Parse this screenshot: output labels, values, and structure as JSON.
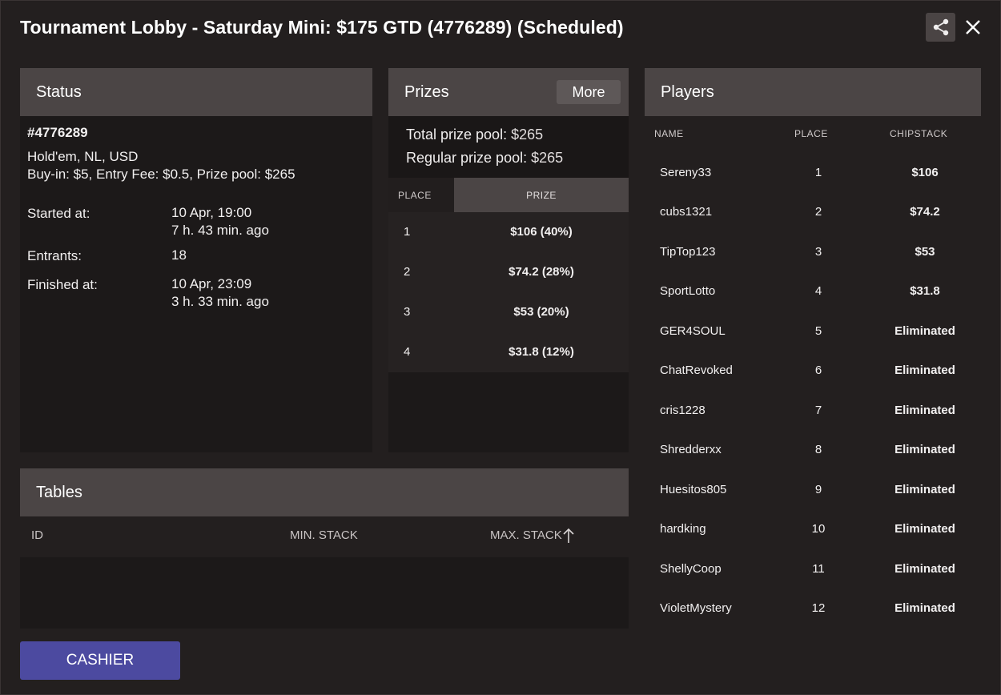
{
  "window": {
    "title": "Tournament Lobby - Saturday Mini: $175 GTD (4776289) (Scheduled)"
  },
  "status": {
    "header": "Status",
    "id": "#4776289",
    "game": "Hold'em, NL, USD",
    "buyin": "Buy-in: $5, Entry Fee: $0.5, Prize pool: $265",
    "started_label": "Started at:",
    "started_date": "10 Apr, 19:00",
    "started_ago": "7 h. 43 min. ago",
    "entrants_label": "Entrants:",
    "entrants_value": "18",
    "finished_label": "Finished at:",
    "finished_date": "10 Apr, 23:09",
    "finished_ago": "3 h. 33 min. ago"
  },
  "prizes": {
    "header": "Prizes",
    "more_label": "More",
    "total_label": "Total prize pool:",
    "total_value": "$265",
    "regular_label": "Regular prize pool:",
    "regular_value": "$265",
    "col_place": "PLACE",
    "col_prize": "PRIZE",
    "rows": [
      {
        "place": "1",
        "prize": "$106 (40%)"
      },
      {
        "place": "2",
        "prize": "$74.2 (28%)"
      },
      {
        "place": "3",
        "prize": "$53 (20%)"
      },
      {
        "place": "4",
        "prize": "$31.8 (12%)"
      }
    ]
  },
  "players": {
    "header": "Players",
    "col_name": "NAME",
    "col_place": "PLACE",
    "col_chipstack": "CHIPSTACK",
    "rows": [
      {
        "name": "Sereny33",
        "place": "1",
        "chips": "$106"
      },
      {
        "name": "cubs1321",
        "place": "2",
        "chips": "$74.2"
      },
      {
        "name": "TipTop123",
        "place": "3",
        "chips": "$53"
      },
      {
        "name": "SportLotto",
        "place": "4",
        "chips": "$31.8"
      },
      {
        "name": "GER4SOUL",
        "place": "5",
        "chips": "Eliminated"
      },
      {
        "name": "ChatRevoked",
        "place": "6",
        "chips": "Eliminated"
      },
      {
        "name": "cris1228",
        "place": "7",
        "chips": "Eliminated"
      },
      {
        "name": "Shredderxx",
        "place": "8",
        "chips": "Eliminated"
      },
      {
        "name": "Huesitos805",
        "place": "9",
        "chips": "Eliminated"
      },
      {
        "name": "hardking",
        "place": "10",
        "chips": "Eliminated"
      },
      {
        "name": "ShellyCoop",
        "place": "11",
        "chips": "Eliminated"
      },
      {
        "name": "VioletMystery",
        "place": "12",
        "chips": "Eliminated"
      }
    ]
  },
  "tables": {
    "header": "Tables",
    "col_id": "ID",
    "col_min": "MIN. STACK",
    "col_max": "MAX. STACK"
  },
  "footer": {
    "cashier_label": "CASHIER"
  },
  "icons": {
    "share": "share-icon",
    "close": "close-icon",
    "sort": "arrow-up-icon"
  },
  "colors": {
    "panel_header": "#4b4545",
    "cashier_button": "#4c4aa0"
  }
}
